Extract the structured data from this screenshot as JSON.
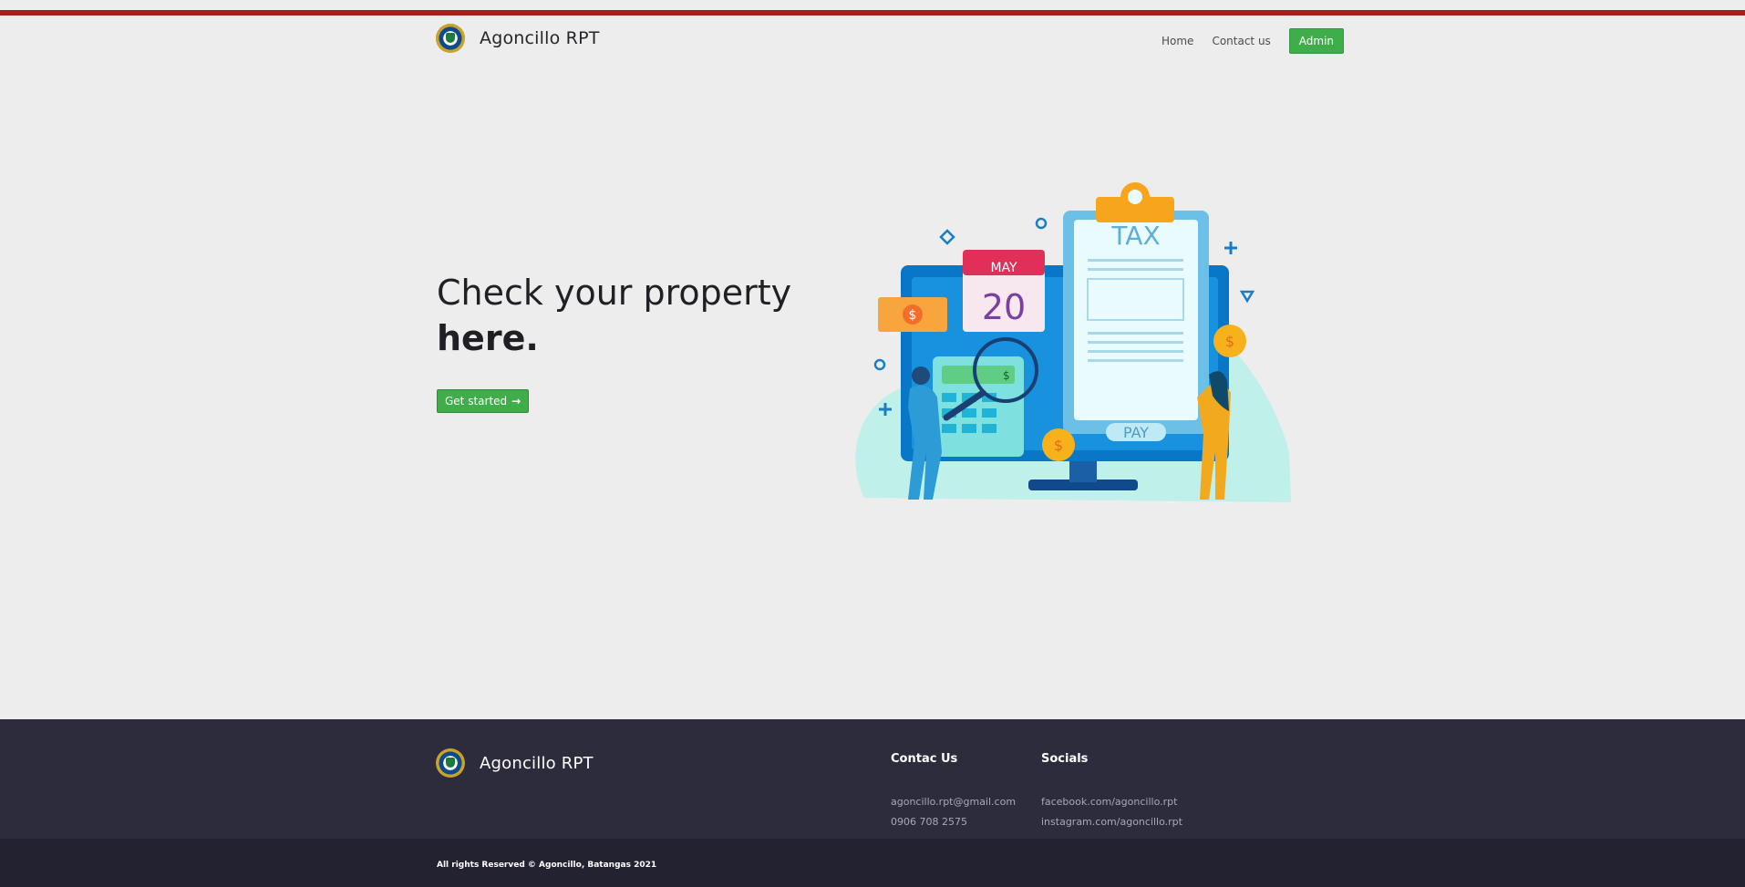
{
  "brand": {
    "name": "Agoncillo RPT",
    "logo_icon": "municipal-seal-icon"
  },
  "nav": {
    "home": "Home",
    "contact": "Contact us",
    "admin": "Admin"
  },
  "hero": {
    "line1": "Check your property",
    "line2": "here",
    "line2_suffix": ".",
    "cta": "Get started",
    "cta_icon": "arrow-right-icon"
  },
  "illustration": {
    "calendar_month": "MAY",
    "calendar_day": "20",
    "doc_title": "TAX",
    "pay_label": "PAY",
    "currency_symbol": "$"
  },
  "footer": {
    "brand": "Agoncillo RPT",
    "contact_heading": "Contac Us",
    "email": "agoncillo.rpt@gmail.com",
    "phone": "0906 708 2575",
    "socials_heading": "Socials",
    "facebook": "facebook.com/agoncillo.rpt",
    "instagram": "instagram.com/agoncillo.rpt"
  },
  "copyright": "All rights Reserved © Agoncillo, Batangas 2021",
  "colors": {
    "accent_red": "#a61d1d",
    "button_green": "#3fae4a",
    "footer_bg": "#2d2c3d",
    "bottom_bar_bg": "#232231",
    "page_bg": "#ededed"
  }
}
